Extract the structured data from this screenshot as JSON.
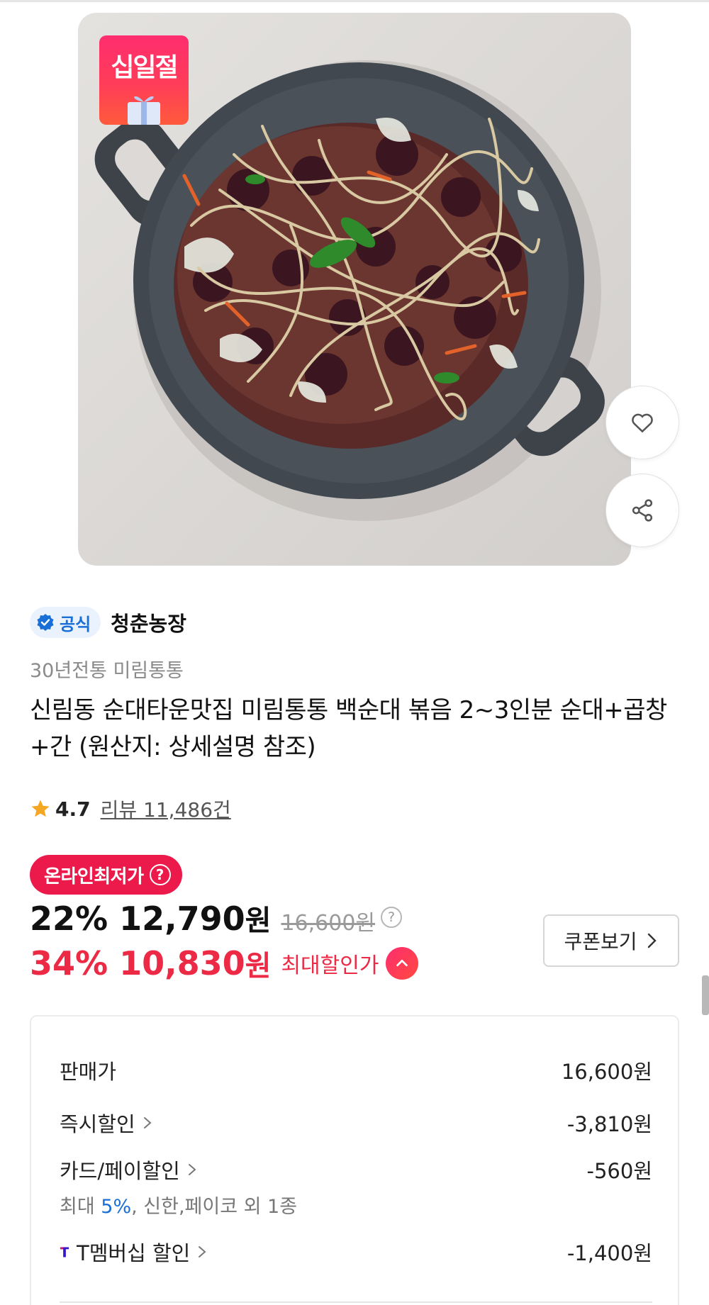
{
  "event_badge": {
    "label": "십일절"
  },
  "seller": {
    "official_label": "공식",
    "name": "청춘농장"
  },
  "brand_line": "30년전통 미림통통",
  "product_title": "신림동 순대타운맛집 미림통통 백순대 볶음 2~3인분 순대+곱창+간 (원산지: 상세설명 참조)",
  "rating": {
    "score": "4.7",
    "reviews": "리뷰 11,486건"
  },
  "price": {
    "lowest_badge": "온라인최저가",
    "question_mark": "?",
    "discount_pct": "22%",
    "sale_amount": "12,790",
    "unit": "원",
    "original_price": "16,600원",
    "max_discount_pct": "34%",
    "max_amount": "10,830",
    "max_label": "최대할인가"
  },
  "coupon_button": {
    "label": "쿠폰보기"
  },
  "breakdown": {
    "sale_price": {
      "label": "판매가",
      "value": "16,600원"
    },
    "instant_discount": {
      "label": "즉시할인",
      "value": "-3,810원"
    },
    "card_pay_discount": {
      "label": "카드/페이할인",
      "value": "-560원",
      "sub_prefix": "최대 ",
      "sub_highlight": "5%",
      "sub_suffix": ", 신한,페이코 외 1종"
    },
    "t_membership": {
      "label": "T멤버십 할인",
      "value": "-1,400원"
    }
  },
  "colors": {
    "accent_red": "#ec2a45",
    "badge_red": "#ec1a4a",
    "official_blue": "#1a6fd6",
    "t_purple": "#3617ce"
  },
  "icons": [
    "heart-icon",
    "share-icon",
    "verified-check-icon",
    "star-icon",
    "chevron-up-icon",
    "chevron-right-icon",
    "t-membership-logo",
    "gift-icon"
  ]
}
